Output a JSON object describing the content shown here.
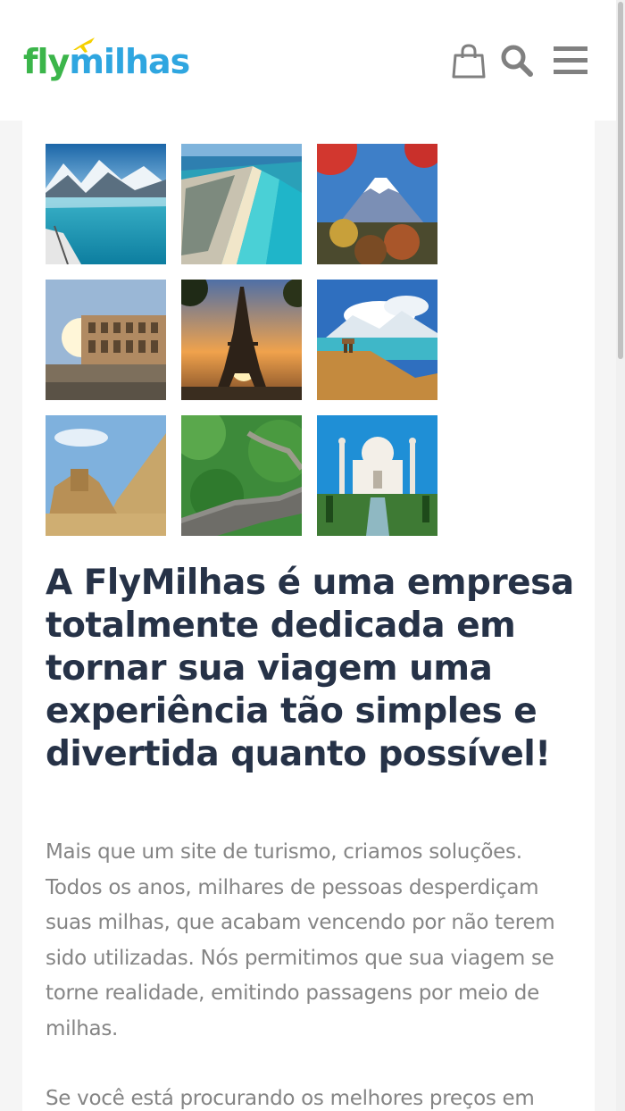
{
  "header": {
    "logo": {
      "part1": "fly",
      "part2": "milhas",
      "color_fly": "#3bb54a",
      "color_milhas": "#2fa6e0"
    },
    "icons": [
      "shopping-bag-icon",
      "search-icon",
      "menu-icon"
    ],
    "icon_color": "#808080"
  },
  "gallery": {
    "images": [
      {
        "name": "glacier-bay-image"
      },
      {
        "name": "cancun-beach-image"
      },
      {
        "name": "mount-fuji-image"
      },
      {
        "name": "colosseum-image"
      },
      {
        "name": "eiffel-tower-image"
      },
      {
        "name": "patagonia-lake-image"
      },
      {
        "name": "sphinx-pyramids-image"
      },
      {
        "name": "great-wall-image"
      },
      {
        "name": "taj-mahal-image"
      }
    ]
  },
  "main": {
    "headline": "A FlyMilhas é uma empresa totalmente dedicada em tornar sua viagem uma experiência tão simples e divertida quanto possível!",
    "paragraph1": "Mais que um site de turismo, criamos soluções. Todos os anos, milhares de pessoas desperdiçam suas milhas, que acabam vencendo por não terem sido utilizadas. Nós permitimos que sua viagem se torne realidade, emitindo passagens por meio de milhas.",
    "paragraph2": "Se você está procurando os melhores preços em",
    "headline_color": "#263247",
    "text_color": "#858585"
  }
}
